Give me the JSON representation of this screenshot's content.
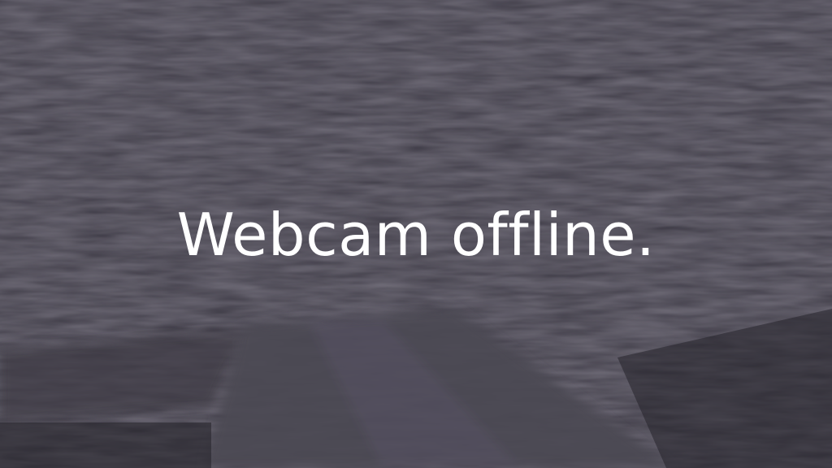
{
  "feed": {
    "status_message": "Webcam offline."
  },
  "colors": {
    "background": "#302d38",
    "foliage_dark": "#27242e",
    "foliage_light": "#4a4652",
    "road": "#4b4853",
    "text": "#ffffff"
  }
}
